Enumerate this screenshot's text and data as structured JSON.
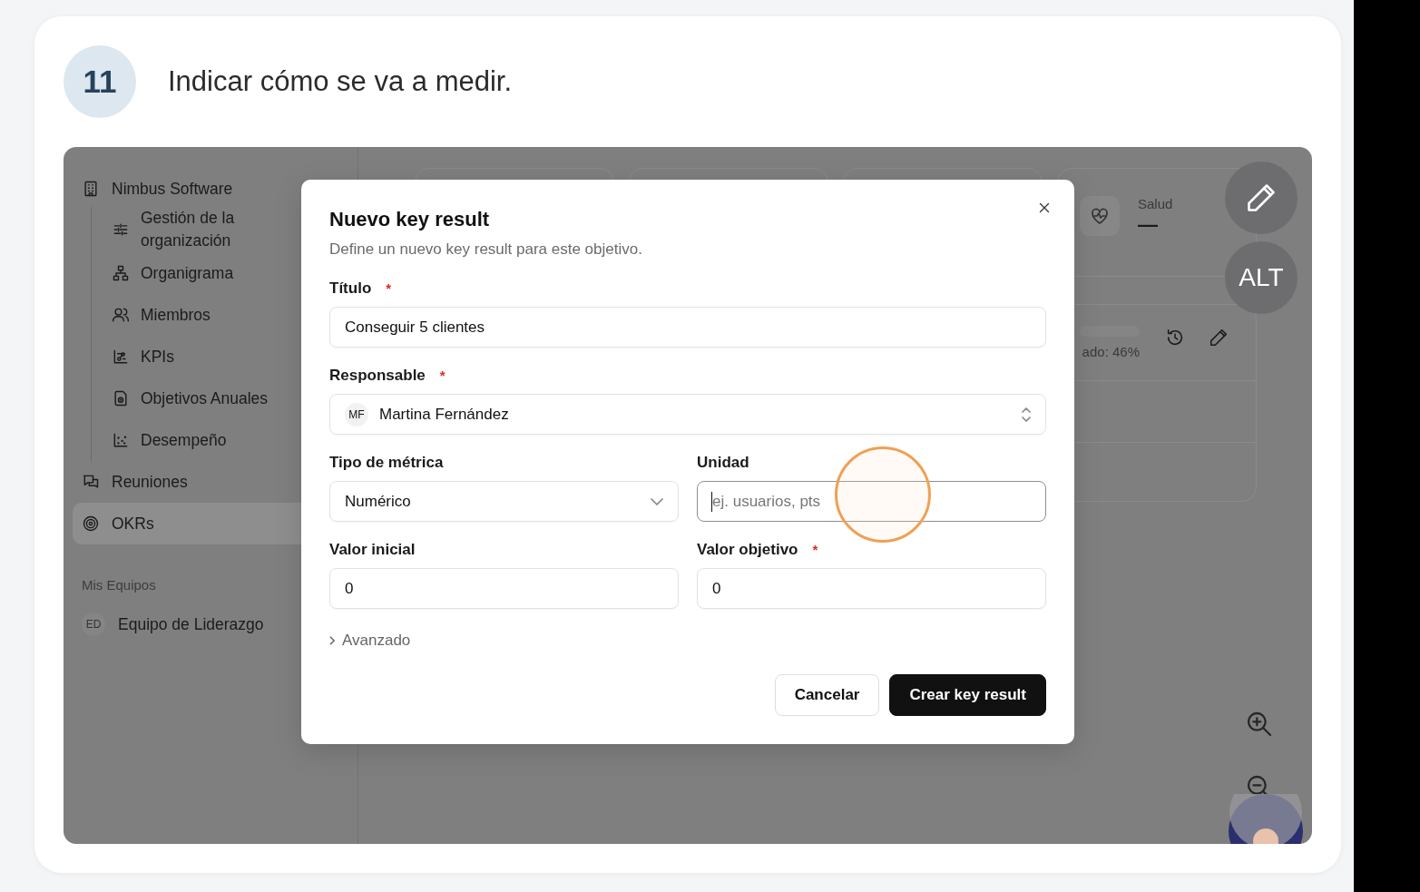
{
  "step": {
    "number": "11",
    "title": "Indicar cómo se va a medir."
  },
  "sidebar": {
    "org": {
      "label": "Nimbus Software",
      "children": [
        {
          "label": "Gestión de la organización",
          "selected": false
        },
        {
          "label": "Organigrama",
          "selected": false
        },
        {
          "label": "Miembros",
          "selected": false
        },
        {
          "label": "KPIs",
          "selected": false
        },
        {
          "label": "Objetivos Anuales",
          "selected": false
        },
        {
          "label": "Desempeño",
          "selected": false
        }
      ]
    },
    "items": [
      {
        "label": "Reuniones",
        "selected": false
      },
      {
        "label": "OKRs",
        "selected": true
      }
    ],
    "teams_heading": "Mis Equipos",
    "teams": [
      {
        "initials": "ED",
        "label": "Equipo de Liderazgo",
        "selected": false
      }
    ]
  },
  "dashboard": {
    "health": {
      "label": "Salud",
      "value": "—"
    },
    "progress_text": "ado: 46%"
  },
  "modal": {
    "title": "Nuevo key result",
    "subtitle": "Define un nuevo key result para este objetivo.",
    "rows": [
      [
        {
          "kind": "text",
          "label": "Título",
          "required_mark": "*",
          "value": "Conseguir 5 clientes",
          "focused": false
        }
      ],
      [
        {
          "kind": "person",
          "label": "Responsable",
          "required_mark": "*",
          "initials": "MF",
          "value": "Martina Fernández"
        }
      ],
      [
        {
          "kind": "select",
          "label": "Tipo de métrica",
          "value": "Numérico"
        },
        {
          "kind": "text",
          "label": "Unidad",
          "placeholder": "ej. usuarios, pts",
          "focused": true
        }
      ],
      [
        {
          "kind": "text",
          "label": "Valor inicial",
          "value": "0",
          "focused": false
        },
        {
          "kind": "text",
          "label": "Valor objetivo",
          "required_mark": "*",
          "value": "0",
          "focused": false
        }
      ]
    ],
    "advanced": {
      "label": "Avanzado",
      "expanded": false
    },
    "buttons": [
      {
        "label": "Cancelar",
        "kind": "secondary"
      },
      {
        "label": "Crear key result",
        "kind": "primary"
      }
    ]
  },
  "floating": {
    "alt_label": "ALT"
  }
}
